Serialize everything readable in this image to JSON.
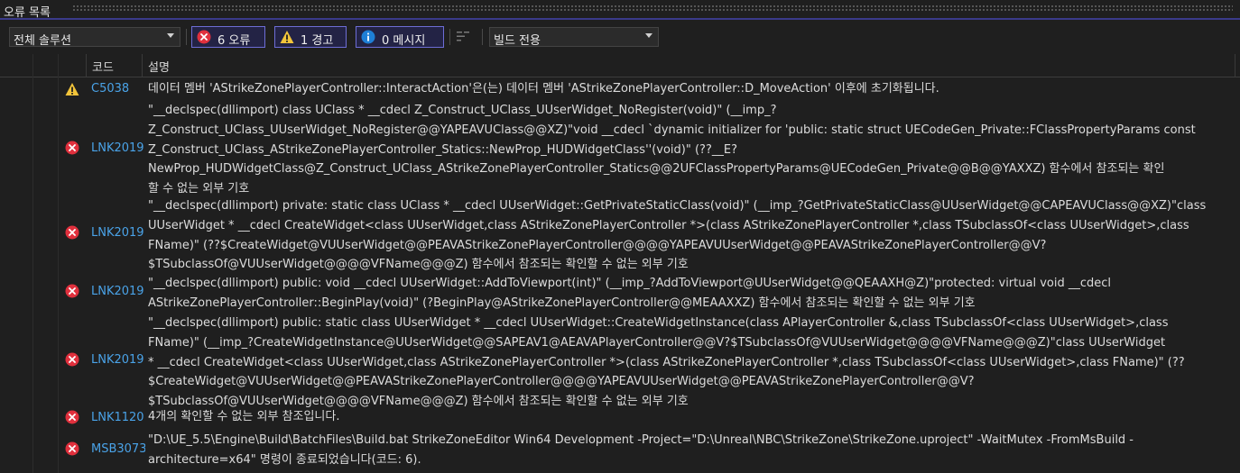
{
  "window": {
    "title": "오류 목록"
  },
  "toolbar": {
    "scope_value": "전체 솔루션",
    "errors_label": "6 오류",
    "warnings_label": "1 경고",
    "messages_label": "0 메시지",
    "build_filter_value": "빌드 전용"
  },
  "columns": {
    "code": "코드",
    "description": "설명"
  },
  "colors": {
    "error": "#e0303d",
    "warning": "#f2c43a",
    "info": "#1e7fd6",
    "code_link": "#4aa3e8"
  },
  "rows": [
    {
      "severity": "warning",
      "code": "C5038",
      "description": "데이터 멤버 'AStrikeZonePlayerController::InteractAction'은(는) 데이터 멤버 'AStrikeZonePlayerController::D_MoveAction' 이후에 초기화됩니다."
    },
    {
      "severity": "error",
      "code": "LNK2019",
      "description": "\"__declspec(dllimport) class UClass * __cdecl Z_Construct_UClass_UUserWidget_NoRegister(void)\" (__imp_?\nZ_Construct_UClass_UUserWidget_NoRegister@@YAPEAVUClass@@XZ)\"void __cdecl `dynamic initializer for 'public: static struct UECodeGen_Private::FClassPropertyParams const\nZ_Construct_UClass_AStrikeZonePlayerController_Statics::NewProp_HUDWidgetClass''(void)\" (??__E?\nNewProp_HUDWidgetClass@Z_Construct_UClass_AStrikeZonePlayerController_Statics@@2UFClassPropertyParams@UECodeGen_Private@@B@@YAXXZ) 함수에서 참조되는 확인\n할 수 없는 외부 기호"
    },
    {
      "severity": "error",
      "code": "LNK2019",
      "description": "\"__declspec(dllimport) private: static class UClass * __cdecl UUserWidget::GetPrivateStaticClass(void)\" (__imp_?GetPrivateStaticClass@UUserWidget@@CAPEAVUClass@@XZ)\"class\nUUserWidget * __cdecl CreateWidget<class UUserWidget,class AStrikeZonePlayerController *>(class AStrikeZonePlayerController *,class TSubclassOf<class UUserWidget>,class\nFName)\" (??$CreateWidget@VUUserWidget@@PEAVAStrikeZonePlayerController@@@@YAPEAVUUserWidget@@PEAVAStrikeZonePlayerController@@V?\n$TSubclassOf@VUUserWidget@@@@VFName@@@Z) 함수에서 참조되는 확인할 수 없는 외부 기호"
    },
    {
      "severity": "error",
      "code": "LNK2019",
      "description": "\"__declspec(dllimport) public: void __cdecl UUserWidget::AddToViewport(int)\" (__imp_?AddToViewport@UUserWidget@@QEAAXH@Z)\"protected: virtual void __cdecl\nAStrikeZonePlayerController::BeginPlay(void)\" (?BeginPlay@AStrikeZonePlayerController@@MEAAXXZ) 함수에서 참조되는 확인할 수 없는 외부 기호"
    },
    {
      "severity": "error",
      "code": "LNK2019",
      "description": "\"__declspec(dllimport) public: static class UUserWidget * __cdecl UUserWidget::CreateWidgetInstance(class APlayerController &,class TSubclassOf<class UUserWidget>,class\nFName)\" (__imp_?CreateWidgetInstance@UUserWidget@@SAPEAV1@AEAVAPlayerController@@V?$TSubclassOf@VUUserWidget@@@@VFName@@@Z)\"class UUserWidget\n* __cdecl CreateWidget<class UUserWidget,class AStrikeZonePlayerController *>(class AStrikeZonePlayerController *,class TSubclassOf<class UUserWidget>,class FName)\" (??\n$CreateWidget@VUUserWidget@@PEAVAStrikeZonePlayerController@@@@YAPEAVUUserWidget@@PEAVAStrikeZonePlayerController@@V?\n$TSubclassOf@VUUserWidget@@@@VFName@@@Z) 함수에서 참조되는 확인할 수 없는 외부 기호"
    },
    {
      "severity": "error",
      "code": "LNK1120",
      "description": "4개의 확인할 수 없는 외부 참조입니다."
    },
    {
      "severity": "error",
      "code": "MSB3073",
      "description": "\"D:\\UE_5.5\\Engine\\Build\\BatchFiles\\Build.bat StrikeZoneEditor Win64 Development -Project=\"D:\\Unreal\\NBC\\StrikeZone\\StrikeZone.uproject\" -WaitMutex -FromMsBuild -\narchitecture=x64\" 명령이 종료되었습니다(코드: 6)."
    }
  ]
}
